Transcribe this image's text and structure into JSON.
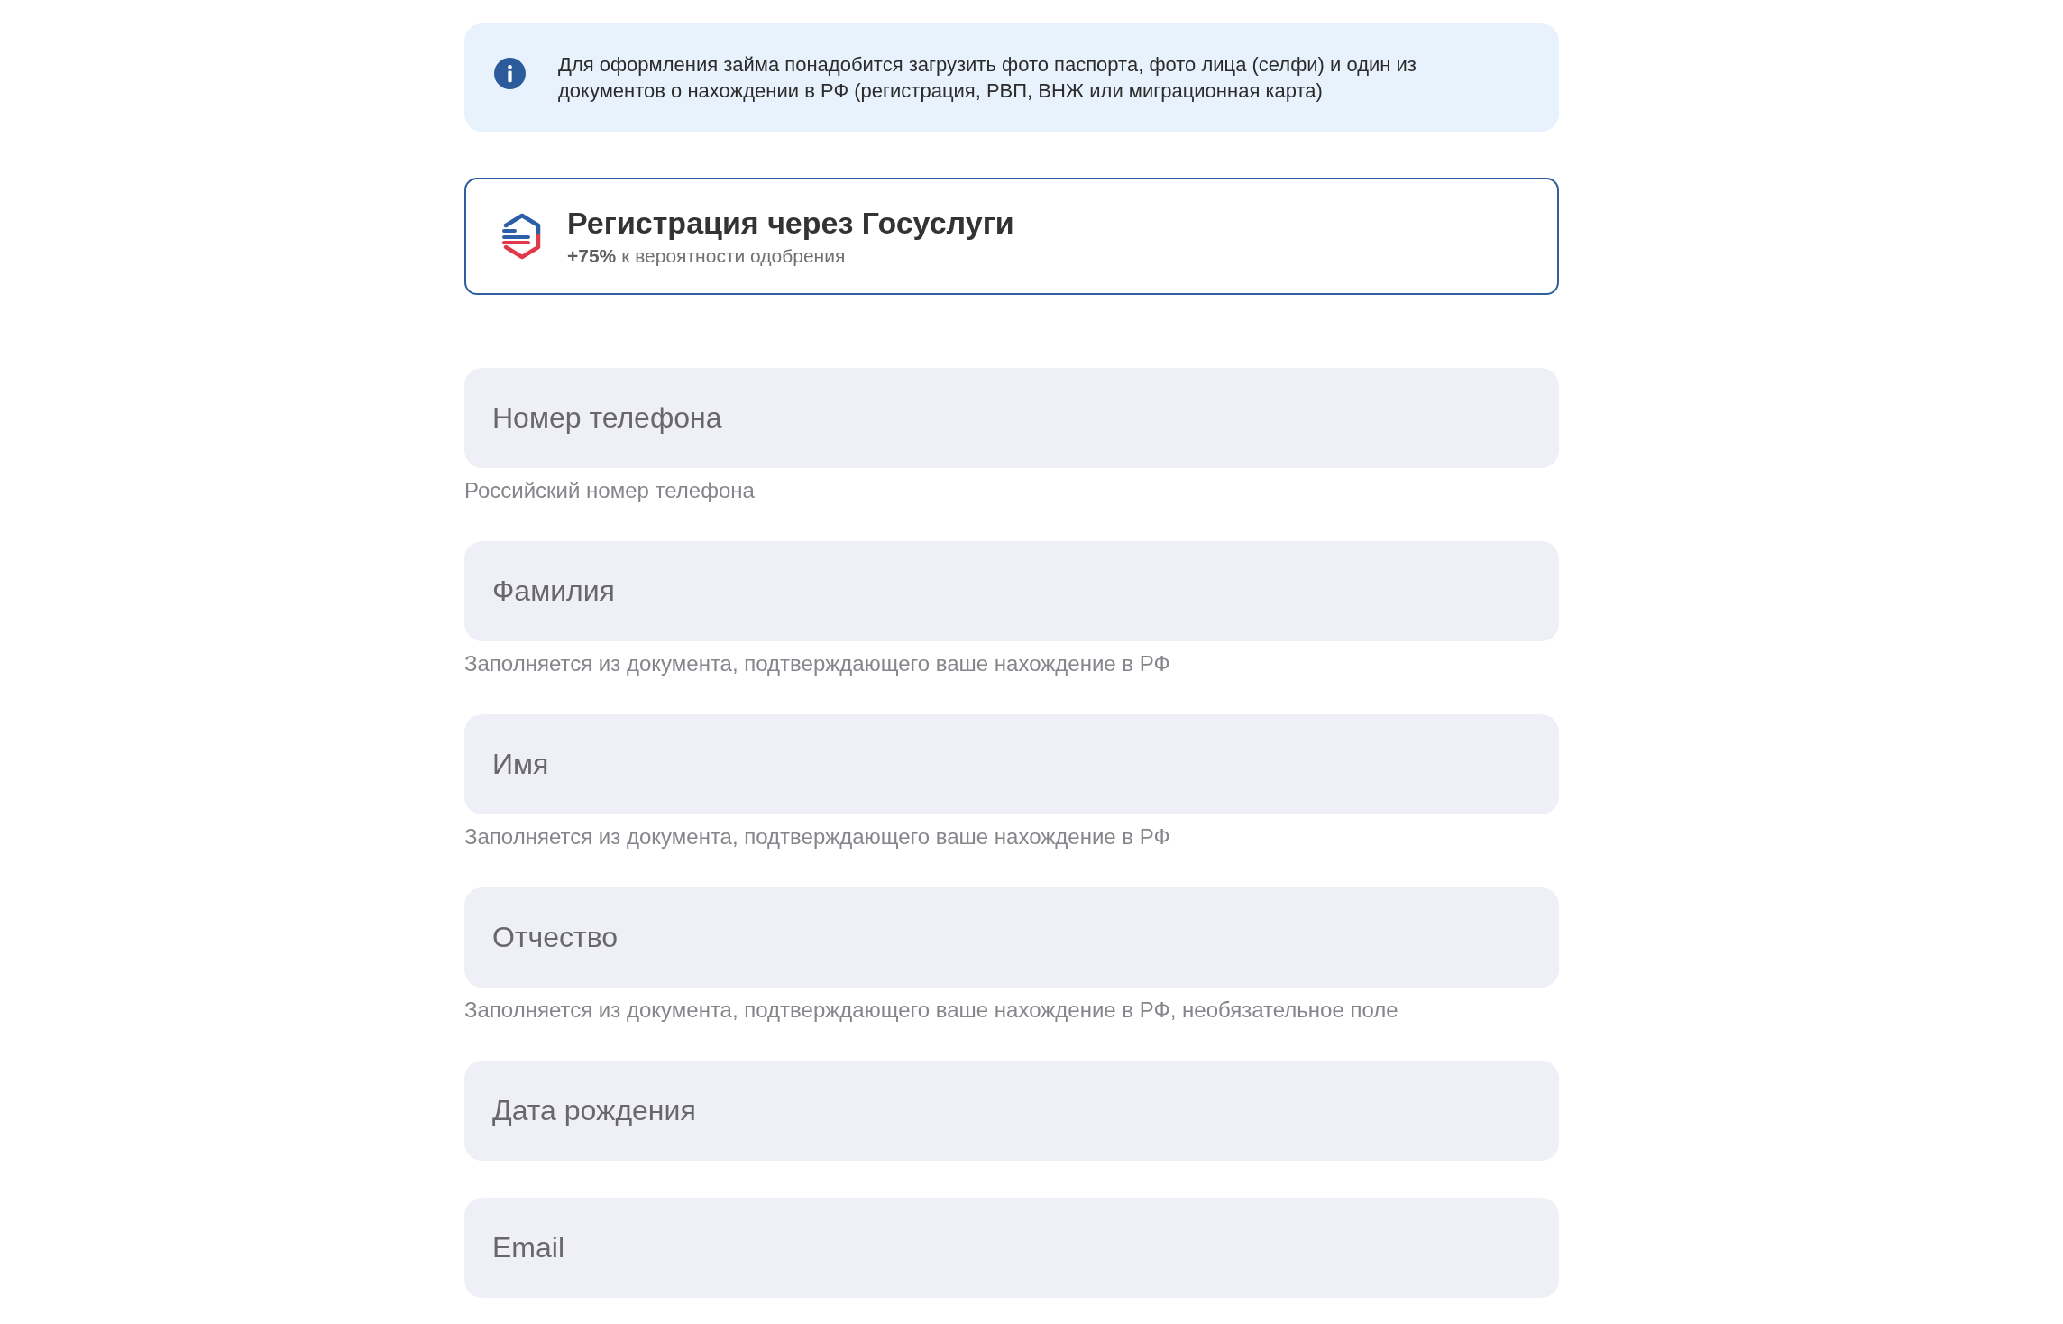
{
  "info_banner": {
    "text": "Для оформления займа понадобится загрузить фото паспорта, фото лица (селфи) и один из документов о нахождении в РФ (регистрация, РВП, ВНЖ или миграционная карта)"
  },
  "gosuslugi_button": {
    "title": "Регистрация через Госуслуги",
    "subtitle": "**+75%** к вероятности одобрения"
  },
  "fields": [
    {
      "placeholder": "Номер телефона",
      "hint": "Российский номер телефона"
    },
    {
      "placeholder": "Фамилия",
      "hint": "Заполняется из документа, подтверждающего ваше нахождение в РФ"
    },
    {
      "placeholder": "Имя",
      "hint": "Заполняется из документа, подтверждающего ваше нахождение в РФ"
    },
    {
      "placeholder": "Отчество",
      "hint": "Заполняется из документа, подтверждающего ваше нахождение в РФ, необязательное поле"
    },
    {
      "placeholder": "Дата рождения"
    },
    {
      "placeholder": "Email"
    }
  ]
}
